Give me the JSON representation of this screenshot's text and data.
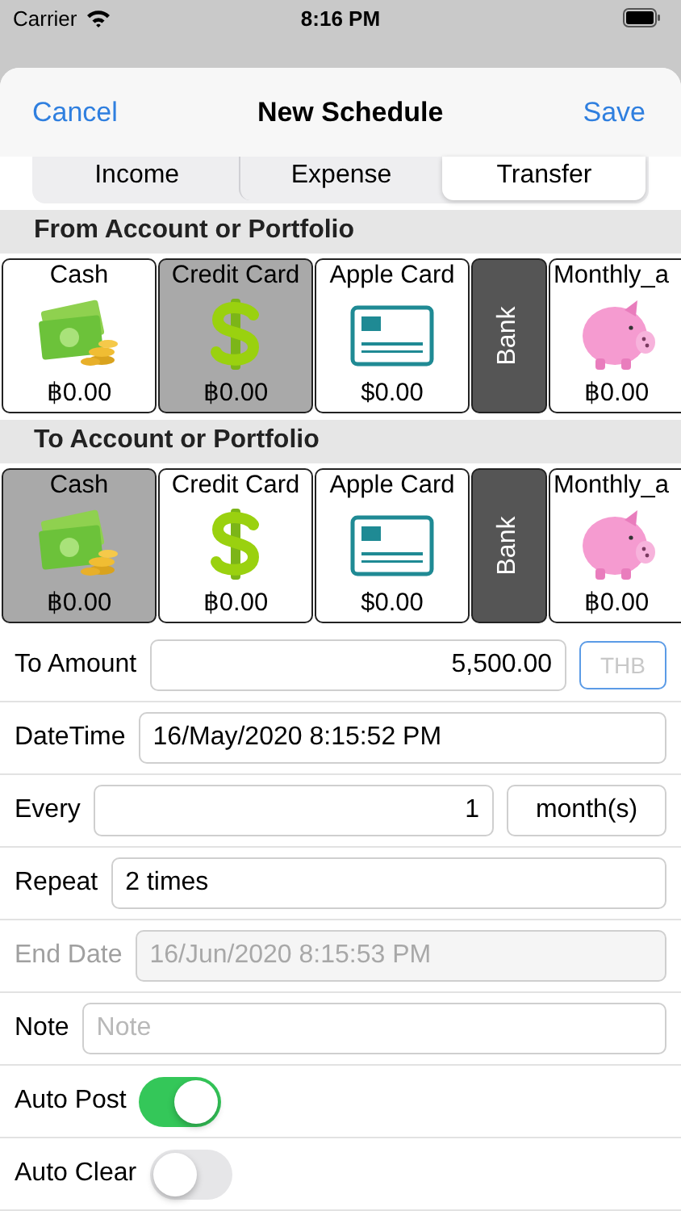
{
  "status_bar": {
    "carrier": "Carrier",
    "time": "8:16 PM"
  },
  "nav": {
    "cancel": "Cancel",
    "title": "New Schedule",
    "save": "Save"
  },
  "segments": [
    {
      "label": "Income",
      "selected": false
    },
    {
      "label": "Expense",
      "selected": false
    },
    {
      "label": "Transfer",
      "selected": true
    }
  ],
  "sections": [
    {
      "title": "From Account or Portfolio",
      "accounts": [
        {
          "name": "Cash",
          "amount": "฿0.00",
          "kind": "cash",
          "selected": false
        },
        {
          "name": "Credit Card",
          "amount": "฿0.00",
          "kind": "dollar",
          "selected": true
        },
        {
          "name": "Apple Card",
          "amount": "$0.00",
          "kind": "card",
          "selected": false
        },
        {
          "name": "Bank",
          "kind": "group",
          "selected": false
        },
        {
          "name": "Monthly_a",
          "amount": "฿0.00",
          "kind": "piggy",
          "selected": false
        }
      ]
    },
    {
      "title": "To Account or Portfolio",
      "accounts": [
        {
          "name": "Cash",
          "amount": "฿0.00",
          "kind": "cash",
          "selected": true
        },
        {
          "name": "Credit Card",
          "amount": "฿0.00",
          "kind": "dollar",
          "selected": false
        },
        {
          "name": "Apple Card",
          "amount": "$0.00",
          "kind": "card",
          "selected": false
        },
        {
          "name": "Bank",
          "kind": "group",
          "selected": false
        },
        {
          "name": "Monthly_a",
          "amount": "฿0.00",
          "kind": "piggy",
          "selected": false
        }
      ]
    }
  ],
  "form": [
    {
      "label": "To Amount",
      "kind": "amount",
      "value": "5,500.00",
      "currency": "THB",
      "disabled": false
    },
    {
      "label": "DateTime",
      "kind": "text",
      "value": "16/May/2020 8:15:52 PM",
      "disabled": false
    },
    {
      "label": "Every",
      "kind": "interval",
      "value": "1",
      "unit": "month(s)",
      "disabled": false
    },
    {
      "label": "Repeat",
      "kind": "text",
      "value": "2 times",
      "disabled": false
    },
    {
      "label": "End Date",
      "kind": "text",
      "value": "16/Jun/2020 8:15:53 PM",
      "disabled": true
    },
    {
      "label": "Note",
      "kind": "text",
      "placeholder": "Note",
      "disabled": false
    },
    {
      "label": "Auto Post",
      "kind": "toggle",
      "on": true,
      "disabled": false
    },
    {
      "label": "Auto Clear",
      "kind": "toggle",
      "on": false,
      "disabled": false
    }
  ]
}
